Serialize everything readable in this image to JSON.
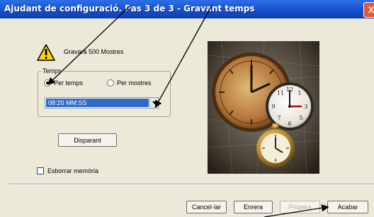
{
  "window": {
    "title": "Ajudant de configuració. Pas 3 de 3 - Gravant temps",
    "close_label": "X"
  },
  "warning": {
    "icon": "warning-icon",
    "text": "Gravarà 500 Mostres"
  },
  "temps_group": {
    "legend": "Temps",
    "radio_per_temps": "Per temps",
    "radio_per_mostres": "Per mostres",
    "selected": "Per temps",
    "combo_value": "08:20 MM:SS"
  },
  "buttons": {
    "disparant": "Disparant",
    "cancel": "Cancel·lar",
    "back": "Enrera",
    "next": "Propera",
    "finish": "Acabar"
  },
  "checkbox": {
    "label": "Esborrar memòria",
    "checked": false
  },
  "photo": {
    "description_icon": "clocks-photo"
  },
  "colors": {
    "titlebar": "#1d5bd6",
    "selection": "#316ac5",
    "window_bg": "#ece9d8"
  }
}
